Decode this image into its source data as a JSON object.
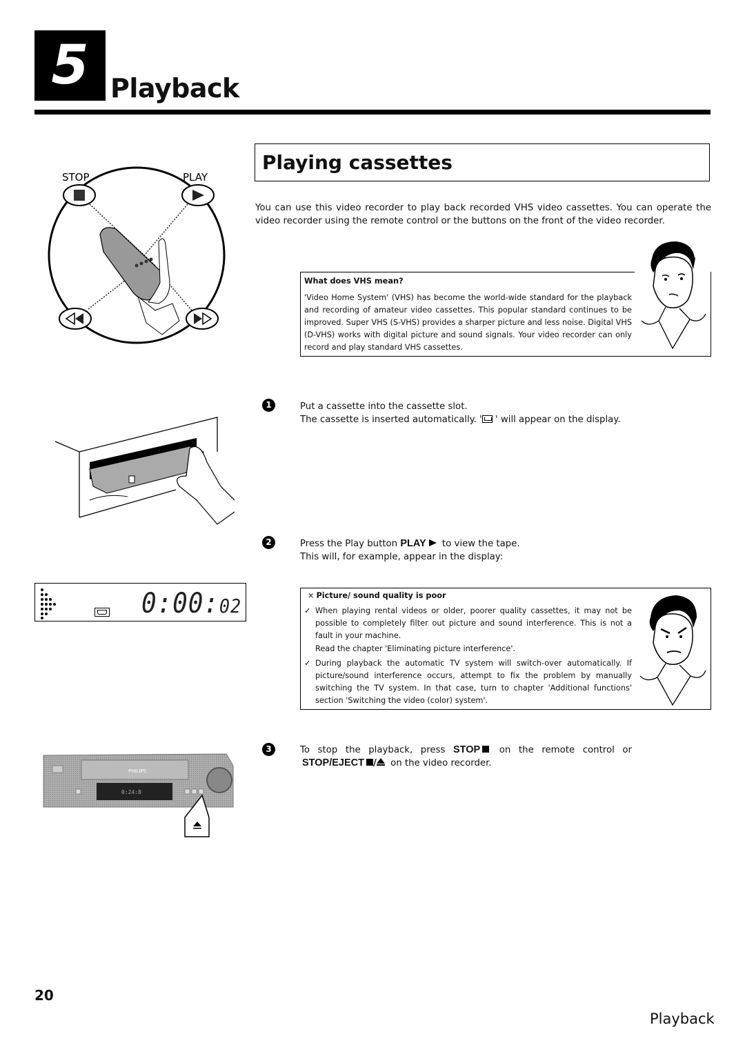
{
  "chapter": {
    "number": "5",
    "title": "Playback"
  },
  "section": {
    "title": "Playing cassettes",
    "intro": "You can use this video recorder to play back recorded VHS video cassettes. You can operate the video recorder using the remote control or the buttons on the front of the video recorder."
  },
  "remote_diagram": {
    "stop_label": "STOP",
    "play_label": "PLAY",
    "icons": [
      "stop-icon",
      "play-icon",
      "rewind-icon",
      "fast-forward-icon"
    ]
  },
  "info_vhs": {
    "title": "What does VHS mean?",
    "body": "'Video Home System' (VHS) has become the world-wide standard for the playback and recording of amateur video cassettes. This popular standard continues to be improved. Super VHS (S-VHS) provides a sharper picture and less noise. Digital VHS (D-VHS) works with digital picture and sound signals. Your video recorder can only record and play standard VHS cassettes."
  },
  "steps": [
    {
      "number": "1",
      "line1": "Put a cassette into the cassette slot.",
      "line2_pre": "The cassette is inserted automatically. '",
      "line2_post": " ' will appear on the display.",
      "icon": "cassette-icon"
    },
    {
      "number": "2",
      "line1_pre": "Press the Play button ",
      "line1_key": "PLAY",
      "line1_post": " to view the tape.",
      "line2": "This will, for example, appear in the display:",
      "icon": "play-icon"
    },
    {
      "number": "3",
      "line1_pre": "To stop the playback, press ",
      "line1_key": "STOP",
      "line1_post": " on the remote control or",
      "line2_key": "STOP/EJECT",
      "line2_post": " on the video recorder.",
      "icons": [
        "stop-icon",
        "eject-icon"
      ]
    }
  ],
  "display": {
    "time_main": "0:00:",
    "time_sec": "02",
    "indicator": "cassette-icon"
  },
  "info_trouble": {
    "marker": "×",
    "title": "Picture/ sound quality is poor",
    "items": [
      {
        "check": "✓",
        "text": "When playing rental videos or older, poorer quality cassettes, it may not be possible to completely filter out picture and sound interference. This is not a fault in your machine.",
        "extra": "Read the chapter 'Eliminating picture interference'."
      },
      {
        "check": "✓",
        "text": "During playback the automatic TV system will switch-over automatically. If picture/sound interference occurs, attempt to fix the problem by manually switching the TV system. In that case, turn to chapter 'Additional functions' section 'Switching the video (color) system'."
      }
    ]
  },
  "recorder_illustration": {
    "brand": "PHILIPS",
    "display_text": "0:24:8"
  },
  "footer": {
    "page_number": "20",
    "title": "Playback"
  }
}
